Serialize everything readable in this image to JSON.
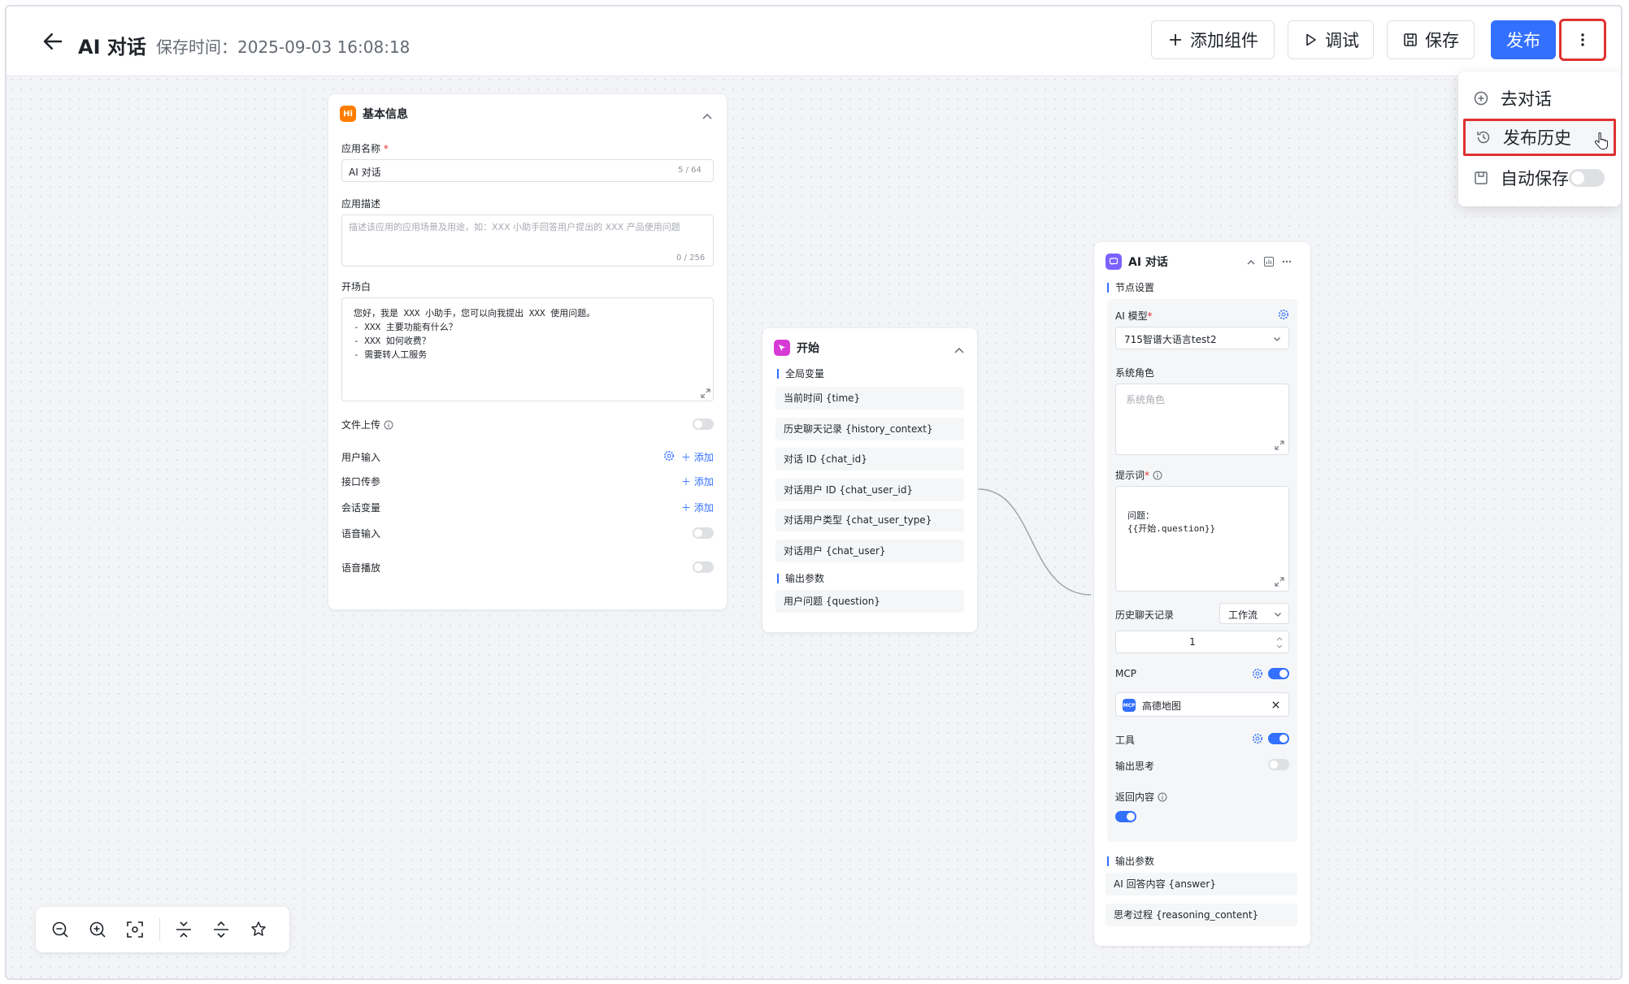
{
  "header": {
    "title": "AI 对话",
    "save_time": "保存时间：2025-09-03 16:08:18",
    "add_component": "添加组件",
    "debug": "调试",
    "save": "保存",
    "publish": "发布"
  },
  "more_menu": {
    "items": [
      "去对话",
      "发布历史",
      "自动保存"
    ]
  },
  "basic_info": {
    "title": "基本信息",
    "badge": "Hi",
    "app_name_label": "应用名称",
    "app_name_value": "AI 对话",
    "app_name_count": "5 / 64",
    "app_desc_label": "应用描述",
    "app_desc_placeholder": "描述该应用的应用场景及用途，如：XXX 小助手回答用户提出的 XXX 产品使用问题",
    "app_desc_count": "0 / 256",
    "prologue_label": "开场白",
    "prologue_lines": [
      "您好，我是 XXX 小助手，您可以向我提出 XXX 使用问题。",
      "- XXX 主要功能有什么？",
      "- XXX 如何收费？",
      "- 需要转人工服务"
    ],
    "file_upload": "文件上传",
    "user_input": "用户输入",
    "api_params": "接口传参",
    "session_vars": "会话变量",
    "add": "添加",
    "voice_input": "语音输入",
    "voice_play": "语音播放"
  },
  "start_node": {
    "title": "开始",
    "global_vars_label": "全局变量",
    "global_vars": [
      "当前时间 {time}",
      "历史聊天记录 {history_context}",
      "对话 ID {chat_id}",
      "对话用户 ID {chat_user_id}",
      "对话用户类型 {chat_user_type}",
      "对话用户 {chat_user}"
    ],
    "output_label": "输出参数",
    "outputs": [
      "用户问题 {question}"
    ]
  },
  "ai_node": {
    "title": "AI 对话",
    "node_settings": "节点设置",
    "model_label": "AI 模型",
    "model_value": "715智谱大语言test2",
    "system_role_label": "系统角色",
    "system_role_placeholder": "系统角色",
    "prompt_label": "提示词",
    "prompt_lines": [
      "问题：",
      "{{开始.question}}"
    ],
    "history_label": "历史聊天记录",
    "history_source": "工作流",
    "history_count": "1",
    "mcp_label": "MCP",
    "mcp_item": "高德地图",
    "mcp_badge": "MCP",
    "tools_label": "工具",
    "output_thinking": "输出思考",
    "return_content": "返回内容",
    "output_label": "输出参数",
    "outputs": [
      "AI 回答内容 {answer}",
      "思考过程 {reasoning_content}"
    ]
  },
  "colors": {
    "primary": "#3370ff",
    "highlight_border": "#e03131",
    "basic_badge": "#ff7d00",
    "start_badge": "#d63ad6",
    "ai_badge": "#7b61ff"
  }
}
